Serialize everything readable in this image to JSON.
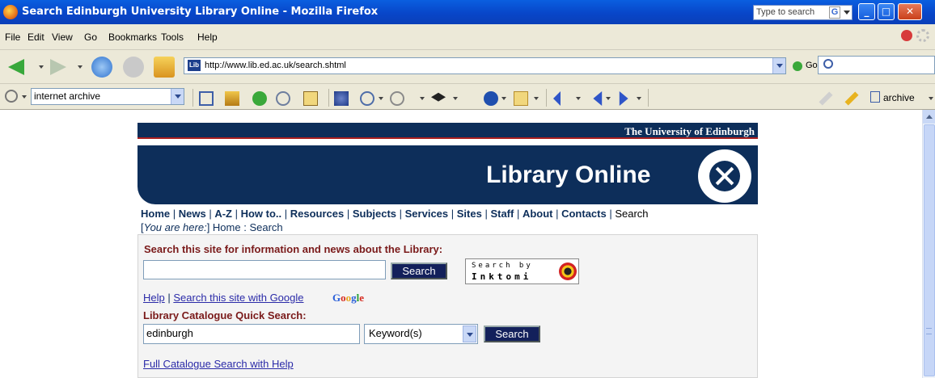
{
  "window": {
    "title": "Search Edinburgh University Library Online - Mozilla Firefox",
    "search_placeholder": "Type to search",
    "search_engine_letter": "G",
    "min_label": "_",
    "max_label": "□",
    "close_label": "✕"
  },
  "menu": [
    {
      "label": "File"
    },
    {
      "label": "Edit"
    },
    {
      "label": "View"
    },
    {
      "label": "Go"
    },
    {
      "label": "Bookmarks"
    },
    {
      "label": "Tools"
    },
    {
      "label": "Help"
    }
  ],
  "navigation": {
    "url": "http://www.lib.ed.ac.uk/search.shtml",
    "favicon_text": "Lib",
    "go_label": "Go"
  },
  "google_toolbar": {
    "query": "internet archive",
    "archive_label": "archive"
  },
  "page": {
    "university_name": "The University of Edinburgh",
    "banner_title": "Library Online",
    "nav_links": [
      {
        "label": "Home"
      },
      {
        "label": "News"
      },
      {
        "label": "A-Z"
      },
      {
        "label": "How to.."
      },
      {
        "label": "Resources"
      },
      {
        "label": "Subjects"
      },
      {
        "label": "Services"
      },
      {
        "label": "Sites"
      },
      {
        "label": "Staff"
      },
      {
        "label": "About"
      },
      {
        "label": "Contacts"
      }
    ],
    "current_page": "Search",
    "breadcrumb_prefix": "You are here:",
    "breadcrumb_home": "Home",
    "breadcrumb_sep": " : ",
    "breadcrumb_current": "Search",
    "site_search_heading": "Search this site for information and news about the Library:",
    "site_search_value": "",
    "site_search_button": "Search",
    "inktomi_line1": "Search by",
    "inktomi_line2": "Inktomi",
    "help_link": "Help",
    "google_search_link": "Search this site with Google",
    "google_logo": "Google",
    "catalogue_heading": "Library Catalogue Quick Search:",
    "catalogue_query": "edinburgh",
    "catalogue_type": "Keyword(s)",
    "catalogue_button": "Search",
    "full_catalogue_link": "Full Catalogue Search with Help"
  }
}
